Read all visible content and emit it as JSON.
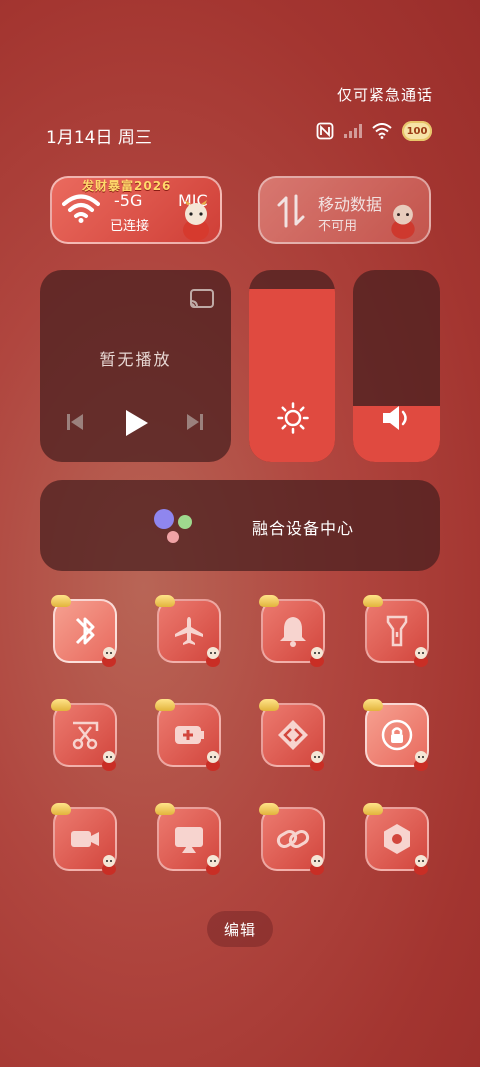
{
  "status_bar": {
    "emergency_text": "仅可紧急通话",
    "date_text": "1月14日 周三",
    "battery_text": "100"
  },
  "wifi_tile": {
    "banner_text": "发财暴富2026",
    "network_name": "-5G",
    "network_name_overflow": "MIC",
    "status_text": "已连接"
  },
  "mobile_data_tile": {
    "title": "移动数据",
    "status_text": "不可用"
  },
  "media": {
    "now_playing": "暂无播放"
  },
  "brightness": {
    "level": 0.9
  },
  "volume": {
    "level": 0.29
  },
  "assistant": {
    "label": "融合设备中心"
  },
  "quick_tiles": [
    {
      "name": "bluetooth",
      "icon": "bluetooth-icon",
      "active": true
    },
    {
      "name": "airplane-mode",
      "icon": "airplane-icon",
      "active": false
    },
    {
      "name": "ring-mode",
      "icon": "bell-icon",
      "active": false
    },
    {
      "name": "flashlight",
      "icon": "flashlight-icon",
      "active": false
    },
    {
      "name": "screenshot",
      "icon": "scissors-icon",
      "active": false
    },
    {
      "name": "power-saving",
      "icon": "battery-plus-icon",
      "active": false
    },
    {
      "name": "share",
      "icon": "share-arrows-icon",
      "active": false
    },
    {
      "name": "rotation-lock",
      "icon": "rotation-lock-icon",
      "active": true
    },
    {
      "name": "screen-record",
      "icon": "video-camera-icon",
      "active": false
    },
    {
      "name": "screen-cast",
      "icon": "cast-screen-icon",
      "active": false
    },
    {
      "name": "link",
      "icon": "link-icon",
      "active": false
    },
    {
      "name": "settings",
      "icon": "hex-gear-icon",
      "active": false
    }
  ],
  "edit_button": {
    "label": "编辑"
  }
}
